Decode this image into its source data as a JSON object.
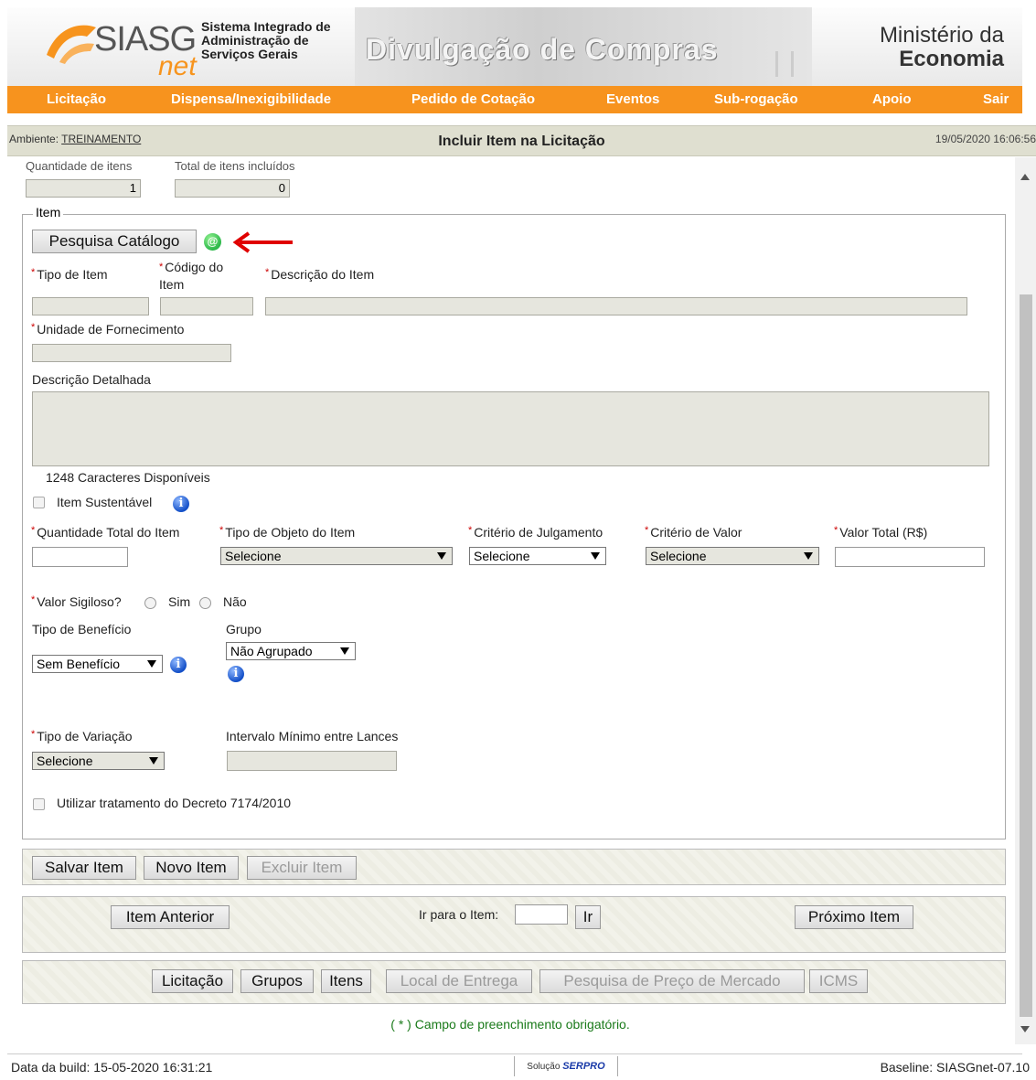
{
  "header": {
    "logo_main": "SIASG",
    "logo_sub": "net",
    "system_name_line1": "Sistema Integrado de",
    "system_name_line2": "Administração de",
    "system_name_line3": "Serviços Gerais",
    "banner_title": "Divulgação de Compras",
    "ministry_line1": "Ministério da",
    "ministry_line2": "Economia"
  },
  "menu": {
    "items": [
      "Licitação",
      "Dispensa/Inexigibilidade",
      "Pedido de Cotação",
      "Eventos",
      "Sub-rogação",
      "Apoio",
      "Sair"
    ]
  },
  "titlebar": {
    "env_label": "Ambiente:",
    "env_value": "TREINAMENTO",
    "page_title": "Incluir Item na Licitação",
    "timestamp": "19/05/2020 16:06:56"
  },
  "counts": {
    "qty_items_label": "Quantidade de itens",
    "qty_items_value": "1",
    "total_included_label": "Total de itens incluídos",
    "total_included_value": "0"
  },
  "item": {
    "legend": "Item",
    "catalog_button": "Pesquisa Catálogo",
    "catalog_status_icon": "@",
    "tipo_item_label": "Tipo de Item",
    "codigo_item_label_1": "Código do",
    "codigo_item_label_2": "Item",
    "descricao_item_label": "Descrição do Item",
    "unidade_label": "Unidade de Fornecimento",
    "descricao_detalhada_label": "Descrição Detalhada",
    "chars_available": "1248 Caracteres Disponíveis",
    "item_sustentavel_label": "Item Sustentável",
    "quantidade_total_label": "Quantidade Total do Item",
    "tipo_objeto_label": "Tipo de Objeto do Item",
    "tipo_objeto_value": "Selecione",
    "criterio_julgamento_label": "Critério de Julgamento",
    "criterio_julgamento_value": "Selecione",
    "criterio_valor_label": "Critério de Valor",
    "criterio_valor_value": "Selecione",
    "valor_total_label": "Valor Total (R$)",
    "valor_sigiloso_label": "Valor Sigiloso?",
    "sim_label": "Sim",
    "nao_label": "Não",
    "tipo_beneficio_label": "Tipo de Benefício",
    "tipo_beneficio_value": "Sem Benefício",
    "grupo_label": "Grupo",
    "grupo_value": "Não Agrupado",
    "tipo_variacao_label": "Tipo de Variação",
    "tipo_variacao_value": "Selecione",
    "intervalo_label": "Intervalo Mínimo entre Lances",
    "decreto_label": "Utilizar tratamento do Decreto 7174/2010",
    "info_glyph": "i"
  },
  "actions": {
    "salvar": "Salvar Item",
    "novo": "Novo Item",
    "excluir": "Excluir Item"
  },
  "navigation": {
    "anterior": "Item Anterior",
    "ir_para_label": "Ir para o Item:",
    "ir": "Ir",
    "proximo": "Próximo Item"
  },
  "tabs": {
    "licitacao": "Licitação",
    "grupos": "Grupos",
    "itens": "Itens",
    "local_entrega": "Local de Entrega",
    "pesquisa_preco": "Pesquisa de Preço de Mercado",
    "icms": "ICMS"
  },
  "required_note": "( * ) Campo de preenchimento obrigatório.",
  "required_mark": "*",
  "footer": {
    "build": "Data da build: 15-05-2020 16:31:21",
    "serpro_prefix": "Solução",
    "serpro_name": "SERPRO",
    "baseline": "Baseline: SIASGnet-07.10"
  },
  "colors": {
    "menu_bg": "#f7931e",
    "required": "#cc0000",
    "annotation_arrow": "#e00000",
    "catalog_status": "#2db84a"
  }
}
